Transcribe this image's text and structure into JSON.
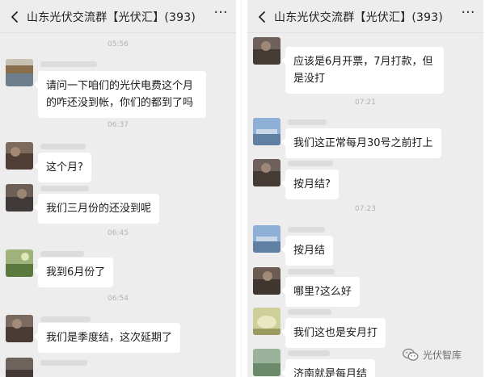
{
  "left": {
    "title": "山东光伏交流群【光伏汇】(393)",
    "more": "···",
    "items": [
      {
        "time": "05:56"
      },
      {
        "text": "请问一下咱们的光伏电费这个月的咋还没到帐，你们的都到了吗"
      },
      {
        "time": "06:37"
      },
      {
        "text": "这个月?"
      },
      {
        "text": "我们三月份的还没到呢"
      },
      {
        "time": "06:45"
      },
      {
        "text": "我到6月份了"
      },
      {
        "time": "06:54"
      },
      {
        "text": "我们是季度结，这次延期了"
      }
    ]
  },
  "right": {
    "title": "山东光伏交流群【光伏汇】(393)",
    "more": "···",
    "items": [
      {
        "text": "应该是6月开票，7月打款，但是没打"
      },
      {
        "time": "07:21"
      },
      {
        "text": "我们这正常每月30号之前打上"
      },
      {
        "text": "按月结?"
      },
      {
        "time": "07:23"
      },
      {
        "text": "按月结"
      },
      {
        "text": "哪里?这么好"
      },
      {
        "text": "我们这也是安月打"
      },
      {
        "text": "济南就是每月结"
      }
    ]
  },
  "watermark": {
    "text": "光伏智库",
    "icon": "wechat-icon"
  },
  "colors": {
    "background": "#ededed",
    "bubble": "#ffffff",
    "timestamp": "#b2b2b2"
  }
}
